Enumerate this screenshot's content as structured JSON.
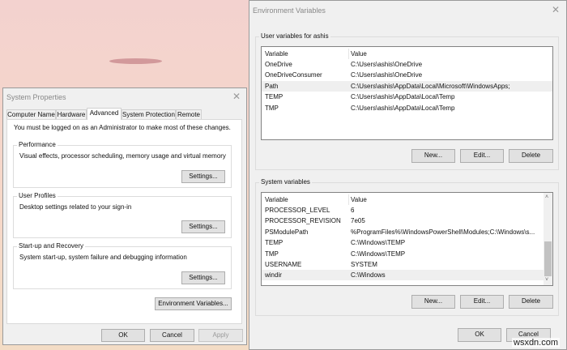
{
  "system_properties": {
    "title": "System Properties",
    "tabs": [
      "Computer Name",
      "Hardware",
      "Advanced",
      "System Protection",
      "Remote"
    ],
    "admin_note": "You must be logged on as an Administrator to make most of these changes.",
    "performance": {
      "label": "Performance",
      "desc": "Visual effects, processor scheduling, memory usage and virtual memory",
      "button": "Settings..."
    },
    "user_profiles": {
      "label": "User Profiles",
      "desc": "Desktop settings related to your sign-in",
      "button": "Settings..."
    },
    "startup": {
      "label": "Start-up and Recovery",
      "desc": "System start-up, system failure and debugging information",
      "button": "Settings..."
    },
    "env_button": "Environment Variables...",
    "ok": "OK",
    "cancel": "Cancel",
    "apply": "Apply"
  },
  "env_vars": {
    "title": "Environment Variables",
    "user_label": "User variables for ashis",
    "headers": [
      "Variable",
      "Value"
    ],
    "user_rows": [
      [
        "OneDrive",
        "C:\\Users\\ashis\\OneDrive"
      ],
      [
        "OneDriveConsumer",
        "C:\\Users\\ashis\\OneDrive"
      ],
      [
        "Path",
        "C:\\Users\\ashis\\AppData\\Local\\Microsoft\\WindowsApps;"
      ],
      [
        "TEMP",
        "C:\\Users\\ashis\\AppData\\Local\\Temp"
      ],
      [
        "TMP",
        "C:\\Users\\ashis\\AppData\\Local\\Temp"
      ]
    ],
    "system_label": "System variables",
    "system_rows": [
      [
        "PROCESSOR_LEVEL",
        "6"
      ],
      [
        "PROCESSOR_REVISION",
        "7e05"
      ],
      [
        "PSModulePath",
        "%ProgramFiles%\\WindowsPowerShell\\Modules;C:\\Windows\\s..."
      ],
      [
        "TEMP",
        "C:\\Windows\\TEMP"
      ],
      [
        "TMP",
        "C:\\Windows\\TEMP"
      ],
      [
        "USERNAME",
        "SYSTEM"
      ],
      [
        "windir",
        "C:\\Windows"
      ]
    ],
    "new": "New...",
    "edit": "Edit...",
    "delete": "Delete",
    "ok": "OK",
    "cancel": "Cancel"
  },
  "watermark": "wsxdn.com"
}
